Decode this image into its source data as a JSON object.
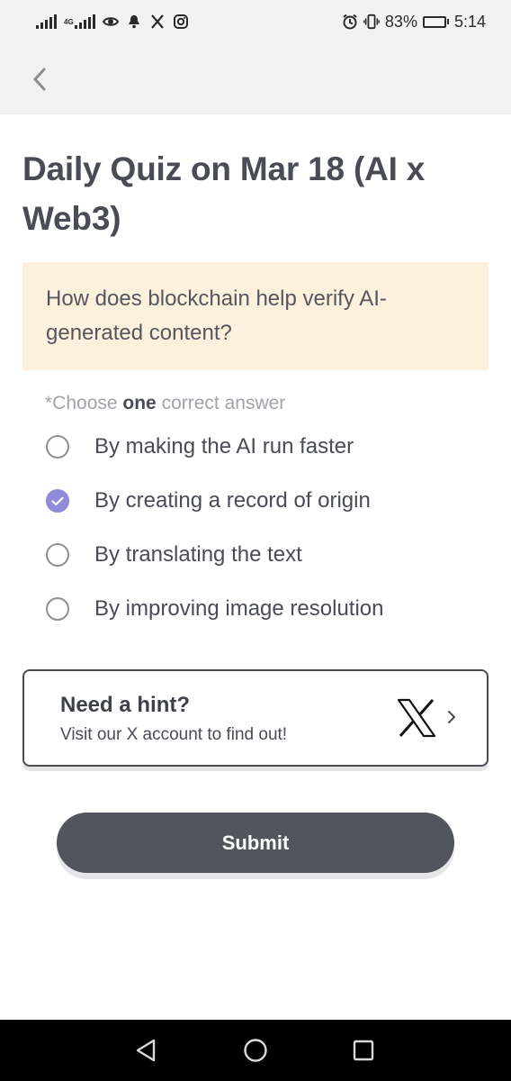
{
  "status_bar": {
    "network_type": "4G",
    "battery_percent": "83%",
    "battery_level": 0.83,
    "time": "5:14",
    "icons": [
      "signal-icon",
      "4g-signal-icon",
      "eye-icon",
      "notification-bell-icon",
      "x-app-icon",
      "instagram-icon",
      "alarm-icon",
      "vibrate-icon",
      "battery-icon"
    ]
  },
  "header": {
    "back_icon": "chevron-left-icon"
  },
  "quiz": {
    "title": "Daily Quiz on Mar 18 (AI x Web3)",
    "question": "How does blockchain help verify AI-generated content?",
    "instruction": {
      "prefix": "*Choose ",
      "emphasis": "one",
      "suffix": " correct answer"
    },
    "options": [
      {
        "label": "By making the AI run faster",
        "selected": false
      },
      {
        "label": "By creating a record of origin",
        "selected": true
      },
      {
        "label": "By translating the text",
        "selected": false
      },
      {
        "label": "By improving image resolution",
        "selected": false
      }
    ]
  },
  "hint": {
    "title": "Need a hint?",
    "subtitle": "Visit our X account to find out!",
    "icon": "x-logo-icon"
  },
  "submit": {
    "label": "Submit"
  },
  "colors": {
    "accent": "#8f8bd8",
    "question_bg": "#fdf0dc",
    "button": "#53555e",
    "header_bg": "#f2f2f3",
    "text": "#4a4c55"
  }
}
